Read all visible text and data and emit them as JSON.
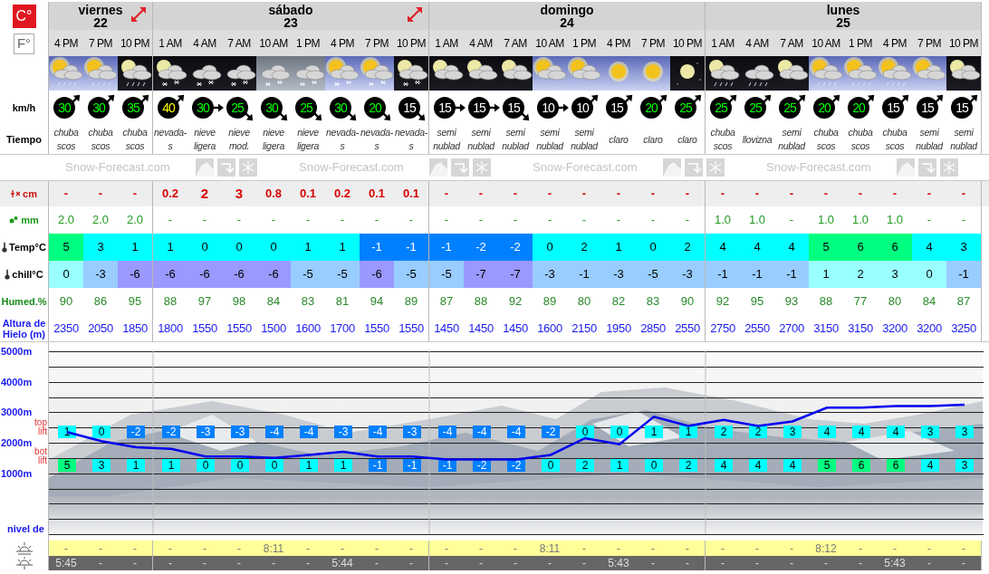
{
  "units": [
    {
      "label": "C°",
      "selected": true
    },
    {
      "label": "F°",
      "selected": false
    }
  ],
  "row_labels": {
    "wind": "km/h",
    "weather": "Tiempo",
    "snow": "cm",
    "rain": "mm",
    "temp": "Temp°C",
    "chill": "chill°C",
    "humidity": "Humed.%",
    "freezing": "Altura de Hielo (m)"
  },
  "branding": [
    "Snow-Forecast.com",
    "Snow-Forecast.com",
    "Snow-Forecast.com",
    "Snow-Forecast.com"
  ],
  "days": [
    {
      "name": "viernes",
      "date": "22",
      "expand": true,
      "columns": [
        {
          "hour": "4 PM",
          "icon": {
            "kind": "showers"
          },
          "wind": {
            "value": "30",
            "color": "#00ff00",
            "kind": "northeast"
          },
          "weather": "chuba scos",
          "snow": {
            "value": "-",
            "kind": "light"
          },
          "rain": "2.0",
          "temp": {
            "value": "5",
            "color": "#00ff80"
          },
          "chill": {
            "value": "0",
            "color": "#99ffff"
          },
          "humidity": "90",
          "freezing": "2350",
          "top_lift": {
            "value": "1",
            "color": "#00ffff"
          },
          "bot_lift": {
            "value": "5",
            "color": "#00ff80"
          },
          "sunrise": "-",
          "sunset": "5:45"
        },
        {
          "hour": "7 PM",
          "icon": {
            "kind": "showers"
          },
          "wind": {
            "value": "30",
            "color": "#00ff00",
            "kind": "northeast"
          },
          "weather": "chuba scos",
          "snow": {
            "value": "-",
            "kind": "light"
          },
          "rain": "2.0",
          "temp": {
            "value": "3",
            "color": "#00ffff"
          },
          "chill": {
            "value": "-3",
            "color": "#99ccff"
          },
          "humidity": "86",
          "freezing": "2050",
          "top_lift": {
            "value": "0",
            "color": "#00ffff"
          },
          "bot_lift": {
            "value": "3",
            "color": "#00ffff"
          },
          "sunrise": "-",
          "sunset": "-"
        },
        {
          "hour": "10 PM",
          "icon": {
            "kind": "nightshowers"
          },
          "wind": {
            "value": "35",
            "color": "#00ff00",
            "kind": "northeast"
          },
          "weather": "chuba scos",
          "snow": {
            "value": "-",
            "kind": "light"
          },
          "rain": "2.0",
          "temp": {
            "value": "1",
            "color": "#00ffff"
          },
          "chill": {
            "value": "-6",
            "color": "#9999ff"
          },
          "humidity": "95",
          "freezing": "1850",
          "top_lift": {
            "value": "-2",
            "color": "#0080ff"
          },
          "bot_lift": {
            "value": "1",
            "color": "#00ffff"
          },
          "sunrise": "-",
          "sunset": "-"
        }
      ]
    },
    {
      "name": "sábado",
      "date": "23",
      "expand": true,
      "columns": [
        {
          "hour": "1 AM",
          "icon": {
            "kind": "nightsnow"
          },
          "wind": {
            "value": "40",
            "color": "#ffff00",
            "kind": "northeast"
          },
          "weather": "nevada-s",
          "snow": {
            "value": "0.2",
            "kind": "light"
          },
          "rain": "-",
          "temp": {
            "value": "1",
            "color": "#00ffff"
          },
          "chill": {
            "value": "-6",
            "color": "#9999ff"
          },
          "humidity": "88",
          "freezing": "1800",
          "top_lift": {
            "value": "-2",
            "color": "#0080ff"
          },
          "bot_lift": {
            "value": "1",
            "color": "#00ffff"
          },
          "sunrise": "-",
          "sunset": "-"
        },
        {
          "hour": "4 AM",
          "icon": {
            "kind": "snow"
          },
          "wind": {
            "value": "30",
            "color": "#00ff00",
            "kind": "east"
          },
          "weather": "nieve ligera",
          "snow": {
            "value": "2",
            "kind": "heavy"
          },
          "rain": "-",
          "temp": {
            "value": "0",
            "color": "#00ffff"
          },
          "chill": {
            "value": "-6",
            "color": "#9999ff"
          },
          "humidity": "97",
          "freezing": "1550",
          "top_lift": {
            "value": "-3",
            "color": "#0080ff"
          },
          "bot_lift": {
            "value": "0",
            "color": "#00ffff"
          },
          "sunrise": "-",
          "sunset": "-"
        },
        {
          "hour": "7 AM",
          "icon": {
            "kind": "snow"
          },
          "wind": {
            "value": "25",
            "color": "#00ff00",
            "kind": "southeast"
          },
          "weather": "nieve mod.",
          "snow": {
            "value": "3",
            "kind": "heavy"
          },
          "rain": "-",
          "temp": {
            "value": "0",
            "color": "#00ffff"
          },
          "chill": {
            "value": "-6",
            "color": "#9999ff"
          },
          "humidity": "98",
          "freezing": "1550",
          "top_lift": {
            "value": "-3",
            "color": "#0080ff"
          },
          "bot_lift": {
            "value": "0",
            "color": "#00ffff"
          },
          "sunrise": "-",
          "sunset": "-"
        },
        {
          "hour": "10 AM",
          "icon": {
            "kind": "greysnow"
          },
          "wind": {
            "value": "30",
            "color": "#00ff00",
            "kind": "southeast"
          },
          "weather": "nieve ligera",
          "snow": {
            "value": "0.8",
            "kind": "light"
          },
          "rain": "-",
          "temp": {
            "value": "0",
            "color": "#00ffff"
          },
          "chill": {
            "value": "-6",
            "color": "#9999ff"
          },
          "humidity": "84",
          "freezing": "1500",
          "top_lift": {
            "value": "-4",
            "color": "#0080ff"
          },
          "bot_lift": {
            "value": "0",
            "color": "#00ffff"
          },
          "sunrise": "8:11",
          "sunset": "-"
        },
        {
          "hour": "1 PM",
          "icon": {
            "kind": "greysnow"
          },
          "wind": {
            "value": "25",
            "color": "#00ff00",
            "kind": "southeast"
          },
          "weather": "nieve ligera",
          "snow": {
            "value": "0.1",
            "kind": "light"
          },
          "rain": "-",
          "temp": {
            "value": "1",
            "color": "#00ffff"
          },
          "chill": {
            "value": "-5",
            "color": "#99ccff"
          },
          "humidity": "83",
          "freezing": "1600",
          "top_lift": {
            "value": "-4",
            "color": "#0080ff"
          },
          "bot_lift": {
            "value": "1",
            "color": "#00ffff"
          },
          "sunrise": "-",
          "sunset": "-"
        },
        {
          "hour": "4 PM",
          "icon": {
            "kind": "sunsnow"
          },
          "wind": {
            "value": "30",
            "color": "#00ff00",
            "kind": "southeast"
          },
          "weather": "nevada-s",
          "snow": {
            "value": "0.2",
            "kind": "light"
          },
          "rain": "-",
          "temp": {
            "value": "1",
            "color": "#00ffff"
          },
          "chill": {
            "value": "-5",
            "color": "#99ccff"
          },
          "humidity": "81",
          "freezing": "1700",
          "top_lift": {
            "value": "-3",
            "color": "#0080ff"
          },
          "bot_lift": {
            "value": "1",
            "color": "#00ffff"
          },
          "sunrise": "-",
          "sunset": "5:44"
        },
        {
          "hour": "7 PM",
          "icon": {
            "kind": "sunsnow"
          },
          "wind": {
            "value": "20",
            "color": "#00ff00",
            "kind": "southeast"
          },
          "weather": "nevada-s",
          "snow": {
            "value": "0.1",
            "kind": "light"
          },
          "rain": "-",
          "temp": {
            "value": "-1",
            "color": "#0080ff"
          },
          "chill": {
            "value": "-6",
            "color": "#9999ff"
          },
          "humidity": "94",
          "freezing": "1550",
          "top_lift": {
            "value": "-4",
            "color": "#0080ff"
          },
          "bot_lift": {
            "value": "-1",
            "color": "#0080ff"
          },
          "sunrise": "-",
          "sunset": "-"
        },
        {
          "hour": "10 PM",
          "icon": {
            "kind": "nightsnow"
          },
          "wind": {
            "value": "15",
            "color": "#ffffff",
            "kind": "southeast"
          },
          "weather": "nevada-s",
          "snow": {
            "value": "0.1",
            "kind": "light"
          },
          "rain": "-",
          "temp": {
            "value": "-1",
            "color": "#0080ff"
          },
          "chill": {
            "value": "-5",
            "color": "#99ccff"
          },
          "humidity": "89",
          "freezing": "1550",
          "top_lift": {
            "value": "-3",
            "color": "#0080ff"
          },
          "bot_lift": {
            "value": "-1",
            "color": "#0080ff"
          },
          "sunrise": "-",
          "sunset": "-"
        }
      ]
    },
    {
      "name": "domingo",
      "date": "24",
      "expand": false,
      "columns": [
        {
          "hour": "1 AM",
          "icon": {
            "kind": "nightcloud"
          },
          "wind": {
            "value": "15",
            "color": "#ffffff",
            "kind": "east"
          },
          "weather": "semi nublad",
          "snow": {
            "value": "-",
            "kind": "light"
          },
          "rain": "-",
          "temp": {
            "value": "-1",
            "color": "#0080ff"
          },
          "chill": {
            "value": "-5",
            "color": "#99ccff"
          },
          "humidity": "87",
          "freezing": "1450",
          "top_lift": {
            "value": "-4",
            "color": "#0080ff"
          },
          "bot_lift": {
            "value": "-1",
            "color": "#0080ff"
          },
          "sunrise": "-",
          "sunset": "-"
        },
        {
          "hour": "4 AM",
          "icon": {
            "kind": "nightcloud"
          },
          "wind": {
            "value": "15",
            "color": "#ffffff",
            "kind": "east"
          },
          "weather": "semi nublad",
          "snow": {
            "value": "-",
            "kind": "light"
          },
          "rain": "-",
          "temp": {
            "value": "-2",
            "color": "#0080ff"
          },
          "chill": {
            "value": "-7",
            "color": "#9999ff"
          },
          "humidity": "88",
          "freezing": "1450",
          "top_lift": {
            "value": "-4",
            "color": "#0080ff"
          },
          "bot_lift": {
            "value": "-2",
            "color": "#0080ff"
          },
          "sunrise": "-",
          "sunset": "-"
        },
        {
          "hour": "7 AM",
          "icon": {
            "kind": "nightcloud"
          },
          "wind": {
            "value": "15",
            "color": "#ffffff",
            "kind": "southeast"
          },
          "weather": "semi nublad",
          "snow": {
            "value": "-",
            "kind": "light"
          },
          "rain": "-",
          "temp": {
            "value": "-2",
            "color": "#0080ff"
          },
          "chill": {
            "value": "-7",
            "color": "#9999ff"
          },
          "humidity": "92",
          "freezing": "1450",
          "top_lift": {
            "value": "-4",
            "color": "#0080ff"
          },
          "bot_lift": {
            "value": "-2",
            "color": "#0080ff"
          },
          "sunrise": "-",
          "sunset": "-"
        },
        {
          "hour": "10 AM",
          "icon": {
            "kind": "suncloud"
          },
          "wind": {
            "value": "10",
            "color": "#ffffff",
            "kind": "east"
          },
          "weather": "semi nublad",
          "snow": {
            "value": "-",
            "kind": "light"
          },
          "rain": "-",
          "temp": {
            "value": "0",
            "color": "#00ffff"
          },
          "chill": {
            "value": "-3",
            "color": "#99ccff"
          },
          "humidity": "89",
          "freezing": "1600",
          "top_lift": {
            "value": "-2",
            "color": "#0080ff"
          },
          "bot_lift": {
            "value": "0",
            "color": "#00ffff"
          },
          "sunrise": "8:11",
          "sunset": "-"
        },
        {
          "hour": "1 PM",
          "icon": {
            "kind": "suncloud"
          },
          "wind": {
            "value": "10",
            "color": "#ffffff",
            "kind": "northeast"
          },
          "weather": "semi nublad",
          "snow": {
            "value": "-",
            "kind": "light"
          },
          "rain": "-",
          "temp": {
            "value": "2",
            "color": "#00ffff"
          },
          "chill": {
            "value": "-1",
            "color": "#99ccff"
          },
          "humidity": "80",
          "freezing": "2150",
          "top_lift": {
            "value": "0",
            "color": "#00ffff"
          },
          "bot_lift": {
            "value": "2",
            "color": "#00ffff"
          },
          "sunrise": "-",
          "sunset": "-"
        },
        {
          "hour": "4 PM",
          "icon": {
            "kind": "sun"
          },
          "wind": {
            "value": "15",
            "color": "#ffffff",
            "kind": "northeast"
          },
          "weather": "claro",
          "snow": {
            "value": "-",
            "kind": "light"
          },
          "rain": "-",
          "temp": {
            "value": "1",
            "color": "#00ffff"
          },
          "chill": {
            "value": "-3",
            "color": "#99ccff"
          },
          "humidity": "82",
          "freezing": "1950",
          "top_lift": {
            "value": "0",
            "color": "#00ffff"
          },
          "bot_lift": {
            "value": "1",
            "color": "#00ffff"
          },
          "sunrise": "-",
          "sunset": "5:43"
        },
        {
          "hour": "7 PM",
          "icon": {
            "kind": "sun"
          },
          "wind": {
            "value": "20",
            "color": "#00ff00",
            "kind": "northeast"
          },
          "weather": "claro",
          "snow": {
            "value": "-",
            "kind": "light"
          },
          "rain": "-",
          "temp": {
            "value": "0",
            "color": "#00ffff"
          },
          "chill": {
            "value": "-5",
            "color": "#99ccff"
          },
          "humidity": "83",
          "freezing": "2850",
          "top_lift": {
            "value": "1",
            "color": "#00ffff"
          },
          "bot_lift": {
            "value": "0",
            "color": "#00ffff"
          },
          "sunrise": "-",
          "sunset": "-"
        },
        {
          "hour": "10 PM",
          "icon": {
            "kind": "moon"
          },
          "wind": {
            "value": "25",
            "color": "#00ff00",
            "kind": "northeast"
          },
          "weather": "claro",
          "snow": {
            "value": "-",
            "kind": "light"
          },
          "rain": "-",
          "temp": {
            "value": "2",
            "color": "#00ffff"
          },
          "chill": {
            "value": "-3",
            "color": "#99ccff"
          },
          "humidity": "90",
          "freezing": "2550",
          "top_lift": {
            "value": "1",
            "color": "#00ffff"
          },
          "bot_lift": {
            "value": "2",
            "color": "#00ffff"
          },
          "sunrise": "-",
          "sunset": "-"
        }
      ]
    },
    {
      "name": "lunes",
      "date": "25",
      "expand": false,
      "columns": [
        {
          "hour": "1 AM",
          "icon": {
            "kind": "nightshowers"
          },
          "wind": {
            "value": "25",
            "color": "#00ff00",
            "kind": "northeast"
          },
          "weather": "chuba scos",
          "snow": {
            "value": "-",
            "kind": "light"
          },
          "rain": "1.0",
          "temp": {
            "value": "4",
            "color": "#00ffff"
          },
          "chill": {
            "value": "-1",
            "color": "#99ccff"
          },
          "humidity": "92",
          "freezing": "2750",
          "top_lift": {
            "value": "2",
            "color": "#00ffff"
          },
          "bot_lift": {
            "value": "4",
            "color": "#00ffff"
          },
          "sunrise": "-",
          "sunset": "-"
        },
        {
          "hour": "4 AM",
          "icon": {
            "kind": "drizzle"
          },
          "wind": {
            "value": "25",
            "color": "#00ff00",
            "kind": "northeast"
          },
          "weather": "llovizna",
          "snow": {
            "value": "-",
            "kind": "light"
          },
          "rain": "1.0",
          "temp": {
            "value": "4",
            "color": "#00ffff"
          },
          "chill": {
            "value": "-1",
            "color": "#99ccff"
          },
          "humidity": "95",
          "freezing": "2550",
          "top_lift": {
            "value": "2",
            "color": "#00ffff"
          },
          "bot_lift": {
            "value": "4",
            "color": "#00ffff"
          },
          "sunrise": "-",
          "sunset": "-"
        },
        {
          "hour": "7 AM",
          "icon": {
            "kind": "nightcloud"
          },
          "wind": {
            "value": "25",
            "color": "#00ff00",
            "kind": "northeast"
          },
          "weather": "semi nublad",
          "snow": {
            "value": "-",
            "kind": "light"
          },
          "rain": "-",
          "temp": {
            "value": "4",
            "color": "#00ffff"
          },
          "chill": {
            "value": "-1",
            "color": "#99ccff"
          },
          "humidity": "93",
          "freezing": "2700",
          "top_lift": {
            "value": "3",
            "color": "#00ffff"
          },
          "bot_lift": {
            "value": "4",
            "color": "#00ffff"
          },
          "sunrise": "-",
          "sunset": "-"
        },
        {
          "hour": "10 AM",
          "icon": {
            "kind": "showers"
          },
          "wind": {
            "value": "20",
            "color": "#00ff00",
            "kind": "northeast"
          },
          "weather": "chuba scos",
          "snow": {
            "value": "-",
            "kind": "light"
          },
          "rain": "1.0",
          "temp": {
            "value": "5",
            "color": "#00ff80"
          },
          "chill": {
            "value": "1",
            "color": "#99ffff"
          },
          "humidity": "88",
          "freezing": "3150",
          "top_lift": {
            "value": "4",
            "color": "#00ffff"
          },
          "bot_lift": {
            "value": "5",
            "color": "#00ff80"
          },
          "sunrise": "8:12",
          "sunset": "-"
        },
        {
          "hour": "1 PM",
          "icon": {
            "kind": "showers"
          },
          "wind": {
            "value": "20",
            "color": "#00ff00",
            "kind": "northeast"
          },
          "weather": "chuba scos",
          "snow": {
            "value": "-",
            "kind": "light"
          },
          "rain": "1.0",
          "temp": {
            "value": "6",
            "color": "#00ff80"
          },
          "chill": {
            "value": "2",
            "color": "#99ffff"
          },
          "humidity": "77",
          "freezing": "3150",
          "top_lift": {
            "value": "4",
            "color": "#00ffff"
          },
          "bot_lift": {
            "value": "6",
            "color": "#00ff80"
          },
          "sunrise": "-",
          "sunset": "-"
        },
        {
          "hour": "4 PM",
          "icon": {
            "kind": "showers"
          },
          "wind": {
            "value": "15",
            "color": "#ffffff",
            "kind": "northeast"
          },
          "weather": "chuba scos",
          "snow": {
            "value": "-",
            "kind": "light"
          },
          "rain": "1.0",
          "temp": {
            "value": "6",
            "color": "#00ff80"
          },
          "chill": {
            "value": "3",
            "color": "#99ffff"
          },
          "humidity": "80",
          "freezing": "3200",
          "top_lift": {
            "value": "4",
            "color": "#00ffff"
          },
          "bot_lift": {
            "value": "6",
            "color": "#00ff80"
          },
          "sunrise": "-",
          "sunset": "5:43"
        },
        {
          "hour": "7 PM",
          "icon": {
            "kind": "suncloud"
          },
          "wind": {
            "value": "15",
            "color": "#ffffff",
            "kind": "northeast"
          },
          "weather": "semi nublad",
          "snow": {
            "value": "-",
            "kind": "light"
          },
          "rain": "-",
          "temp": {
            "value": "4",
            "color": "#00ffff"
          },
          "chill": {
            "value": "0",
            "color": "#99ffff"
          },
          "humidity": "84",
          "freezing": "3200",
          "top_lift": {
            "value": "3",
            "color": "#00ffff"
          },
          "bot_lift": {
            "value": "4",
            "color": "#00ffff"
          },
          "sunrise": "-",
          "sunset": "-"
        },
        {
          "hour": "10 PM",
          "icon": {
            "kind": "nightcloud"
          },
          "wind": {
            "value": "15",
            "color": "#ffffff",
            "kind": "northeast"
          },
          "weather": "semi nublad",
          "snow": {
            "value": "-",
            "kind": "light"
          },
          "rain": "-",
          "temp": {
            "value": "3",
            "color": "#00ffff"
          },
          "chill": {
            "value": "-1",
            "color": "#99ccff"
          },
          "humidity": "87",
          "freezing": "3250",
          "top_lift": {
            "value": "3",
            "color": "#00ffff"
          },
          "bot_lift": {
            "value": "3",
            "color": "#00ffff"
          },
          "sunrise": "-",
          "sunset": "-"
        }
      ]
    }
  ],
  "chart": {
    "top_label": "top lift",
    "bot_label": "bot lift",
    "base_label": "nivel de",
    "chart_data": {
      "type": "line",
      "grid": true,
      "ylim": [
        -1000,
        5000
      ],
      "yticks": [
        {
          "value": 5000,
          "label": "5000m"
        },
        {
          "value": 4000,
          "label": "4000m"
        },
        {
          "value": 3000,
          "label": "3000m"
        },
        {
          "value": 2000,
          "label": "2000m"
        },
        {
          "value": 1000,
          "label": "1000m"
        }
      ],
      "series": [
        {
          "color": "#0000ee",
          "values": [
            2350,
            2050,
            1850,
            1800,
            1550,
            1550,
            1500,
            1600,
            1700,
            1550,
            1550,
            1450,
            1450,
            1450,
            1600,
            2150,
            1950,
            2850,
            2550,
            2750,
            2550,
            2700,
            3150,
            3150,
            3200,
            3200,
            3250
          ]
        }
      ]
    }
  }
}
